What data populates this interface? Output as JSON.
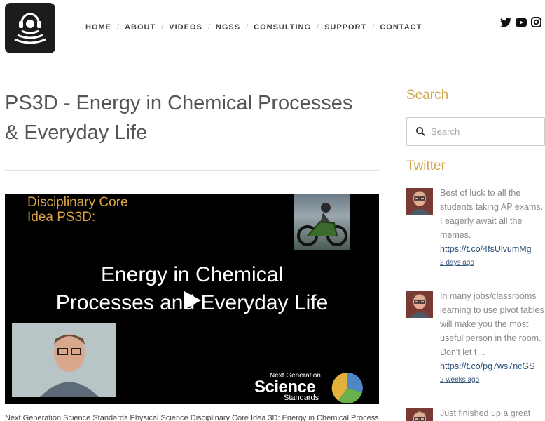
{
  "nav": {
    "items": [
      "HOME",
      "ABOUT",
      "VIDEOS",
      "NGSS",
      "CONSULTING",
      "SUPPORT",
      "CONTACT"
    ],
    "separator": "/"
  },
  "social": {
    "icons": [
      "twitter-icon",
      "youtube-icon",
      "instagram-icon"
    ]
  },
  "main": {
    "title": "PS3D - Energy in Chemical Processes & Everyday Life",
    "video": {
      "header_line1": "Disciplinary Core",
      "header_line2": "Idea PS3D:",
      "title_line1": "Energy in Chemical",
      "title_line2": "Processes and Everyday Life",
      "ngss_top": "Next Generation",
      "ngss_main": "Science",
      "ngss_bottom": "Standards"
    },
    "cut_text": "Next Generation Science Standards Physical Science Disciplinary Core Idea 3D: Energy in Chemical Processes"
  },
  "sidebar": {
    "search_heading": "Search",
    "search_placeholder": "Search",
    "twitter_heading": "Twitter",
    "tweets": [
      {
        "text": "Best of luck to all the students taking AP exams. I eagerly await all the memes.",
        "link": "https://t.co/4fsUlvumMg",
        "time": "2 days ago"
      },
      {
        "text": "In many jobs/classrooms learning to use pivot tables will make you the most useful person in the room. Don't let t…",
        "link": "https://t.co/pg7ws7ncGS",
        "time": "2 weeks ago"
      },
      {
        "text": "Just finished up a great",
        "link": "",
        "time": ""
      }
    ]
  },
  "colors": {
    "accent": "#d4a74f",
    "link": "#2a4f7a",
    "logo_bg": "#1c1c1c"
  }
}
